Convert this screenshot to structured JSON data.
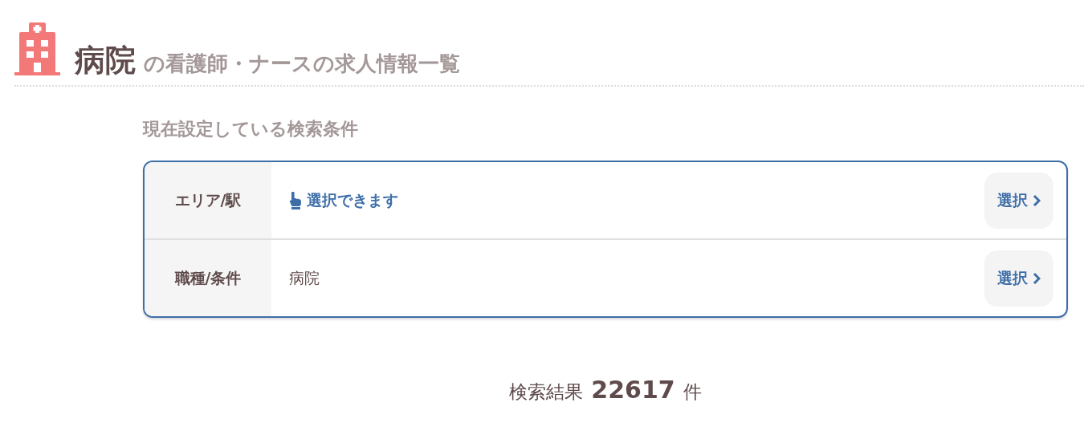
{
  "header": {
    "title": "病院",
    "subtitle": "の看護師・ナースの求人情報一覧"
  },
  "conditions": {
    "heading": "現在設定している検索条件",
    "rows": [
      {
        "label": "エリア/駅",
        "kind": "prompt",
        "value": "選択できます",
        "button": "選択"
      },
      {
        "label": "職種/条件",
        "kind": "value",
        "value": "病院",
        "button": "選択"
      }
    ]
  },
  "results": {
    "label": "検索結果",
    "count": "22617",
    "unit": "件"
  }
}
